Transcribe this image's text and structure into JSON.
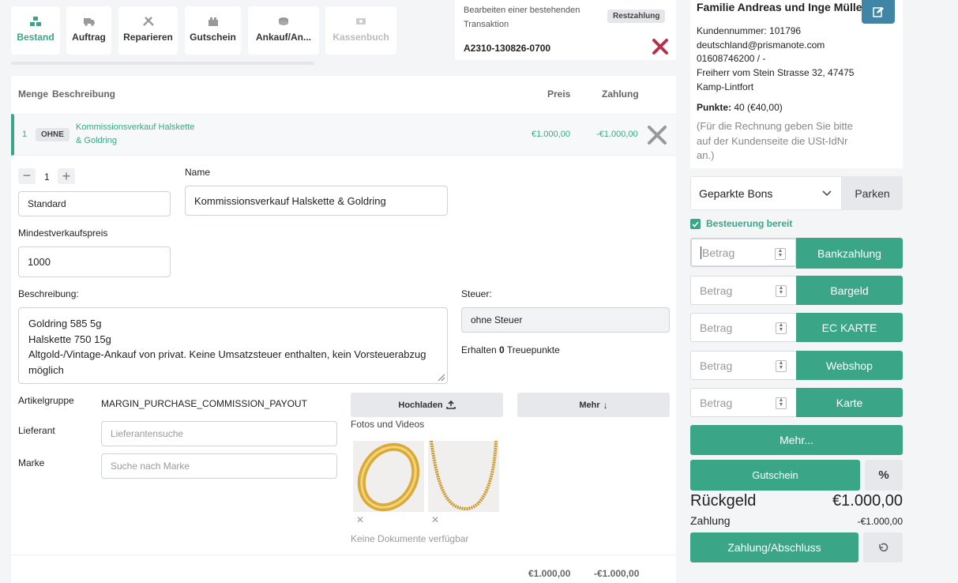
{
  "tabs": [
    {
      "label": "Bestand",
      "icon": "inventory-icon",
      "state": "active"
    },
    {
      "label": "Auftrag",
      "icon": "truck-icon",
      "state": "normal"
    },
    {
      "label": "Reparieren",
      "icon": "tools-icon",
      "state": "normal"
    },
    {
      "label": "Gutschein",
      "icon": "gift-card-icon",
      "state": "normal"
    },
    {
      "label": "Ankauf/An...",
      "icon": "coins-icon",
      "state": "normal"
    },
    {
      "label": "Kassenbuch",
      "icon": "cash-register-icon",
      "state": "disabled"
    }
  ],
  "transaction": {
    "info": "Bearbeiten einer bestehenden Transaktion",
    "badge": "Restzahlung",
    "number": "A2310-130826-0700"
  },
  "table": {
    "headers": {
      "qty": "Menge",
      "desc": "Beschreibung",
      "price": "Preis",
      "payment": "Zahlung"
    },
    "row": {
      "qty": "1",
      "badge": "OHNE",
      "name_line1": "Kommissionsverkauf Halskette",
      "name_line2": "& Goldring",
      "price": "€1.000,00",
      "payment": "-€1.000,00"
    }
  },
  "details": {
    "qty": "1",
    "type_value": "Standard",
    "name_label": "Name",
    "name_value": "Kommissionsverkauf Halskette & Goldring",
    "min_price_label": "Mindestverkaufspreis",
    "min_price_value": "1000",
    "description_label": "Beschreibung:",
    "description_lines": [
      "Goldring 585 5g",
      "Halskette 750 15g",
      "Altgold-/Vintage-Ankauf von privat. Keine Umsatzsteuer enthalten, kein Vorsteuerabzug",
      "möglich"
    ],
    "tax_label": "Steuer:",
    "tax_value": "ohne Steuer",
    "points_prefix": "Erhalten",
    "points_value": "0",
    "points_suffix": "Treuepunkte",
    "article_group_label": "Artikelgruppe",
    "article_group_value": "MARGIN_PURCHASE_COMMISSION_PAYOUT",
    "supplier_label": "Lieferant",
    "supplier_placeholder": "Lieferantensuche",
    "brand_label": "Marke",
    "brand_placeholder": "Suche nach Marke",
    "upload_label": "Hochladen",
    "more_label": "Mehr",
    "photos_label": "Fotos und Videos",
    "no_documents": "Keine Dokumente verfügbar"
  },
  "footer": {
    "price_total": "€1.000,00",
    "payment_total": "-€1.000,00"
  },
  "customer": {
    "name": "Familie Andreas und Inge Müller",
    "customer_number": "Kundennummer: 101796",
    "email": "deutschland@prismanote.com",
    "phone": "01608746200 / -",
    "address1": "Freiherr vom Stein Strasse 32, 47475",
    "address2": "Kamp-Lintfort",
    "points_label": "Punkte:",
    "points_value": "40 (€40,00)",
    "vat_note_1": "(Für die Rechnung geben Sie bitte",
    "vat_note_2": "auf der Kundenseite die USt-IdNr",
    "vat_note_3": "an.)"
  },
  "parked": {
    "select_value": "Geparkte Bons",
    "park_label": "Parken"
  },
  "tax_ready_label": "Besteuerung bereit",
  "payment_methods": [
    {
      "placeholder": "Betrag",
      "label": "Bankzahlung"
    },
    {
      "placeholder": "Betrag",
      "label": "Bargeld"
    },
    {
      "placeholder": "Betrag",
      "label": "EC KARTE"
    },
    {
      "placeholder": "Betrag",
      "label": "Webshop"
    },
    {
      "placeholder": "Betrag",
      "label": "Karte"
    }
  ],
  "more_payment_label": "Mehr...",
  "voucher_label": "Gutschein",
  "percent_label": "%",
  "change_label": "Rückgeld",
  "change_value": "€1.000,00",
  "payment_label": "Zahlung",
  "payment_value": "-€1.000,00",
  "finish_label": "Zahlung/Abschluss",
  "colors": {
    "accent": "#3aa687",
    "danger": "#b5334a",
    "edit": "#3f86a6"
  }
}
